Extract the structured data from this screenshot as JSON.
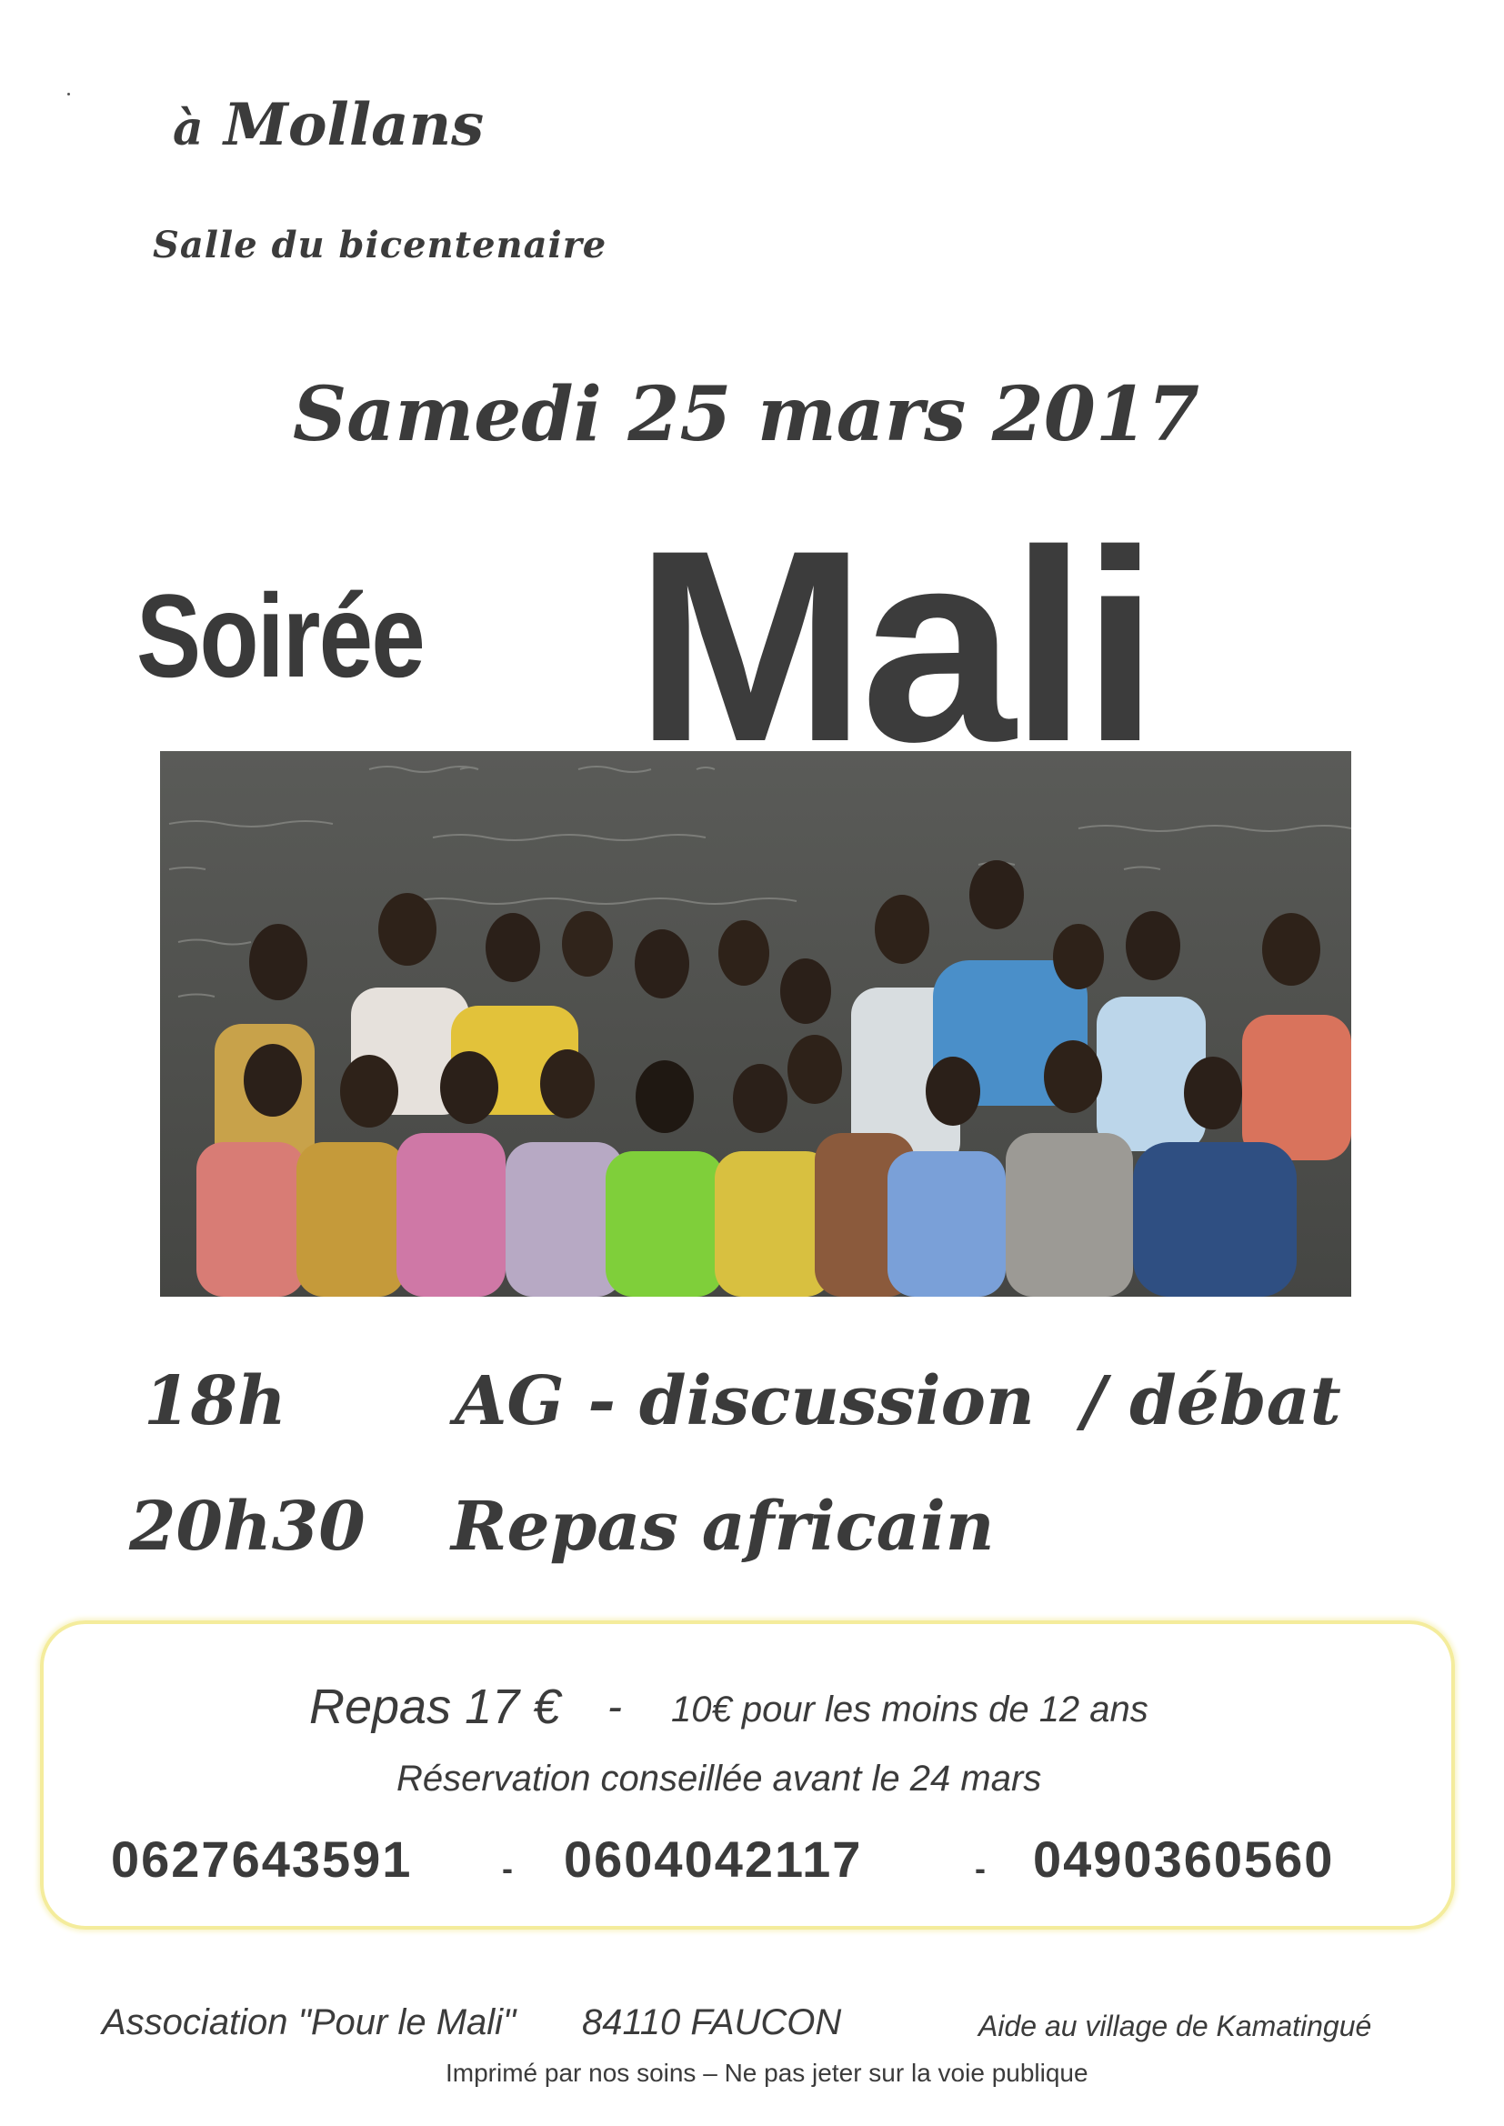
{
  "location": {
    "prefix": "à",
    "town": "Mollans",
    "venue": "Salle du bicentenaire"
  },
  "date": "Samedi 25 mars 2017",
  "title": {
    "word1": "Soirée",
    "word2": "Mali"
  },
  "schedule": [
    {
      "time": "18h",
      "label": "AG - discussion  / débat"
    },
    {
      "time": "20h30",
      "label": "Repas africain"
    }
  ],
  "info": {
    "price_main": "Repas 17 €",
    "price_dash": "-",
    "price_kids": "10€ pour les moins de 12 ans",
    "reservation": "Réservation conseillée avant le 24 mars",
    "phones": [
      "0627643591",
      "0604042117",
      "0490360560"
    ],
    "separator": "-"
  },
  "footer": {
    "association": "Association \"Pour le Mali\"",
    "postcode": "84110 FAUCON",
    "aid": "Aide au village de Kamatingué",
    "printed": "Imprimé par nos soins – Ne pas jeter sur la voie publique"
  },
  "colors": {
    "text": "#3a3a3a",
    "box_border": "#f4ec9c",
    "chalkboard": "#4e4f4c"
  }
}
